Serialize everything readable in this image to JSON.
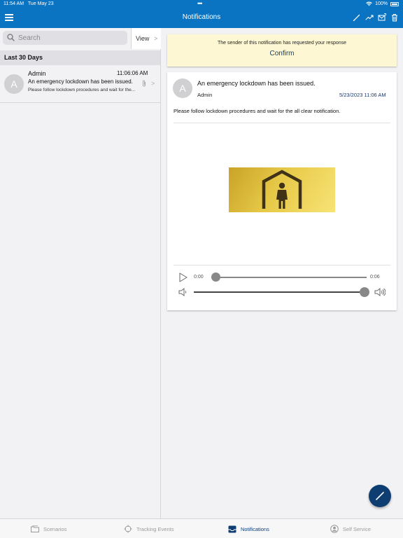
{
  "status": {
    "time": "11:54 AM",
    "date": "Tue May 23",
    "battery": "100%"
  },
  "navbar": {
    "title": "Notifications",
    "icons": [
      "menu-icon",
      "pencil-icon",
      "trend-icon",
      "mail-icon",
      "trash-icon"
    ]
  },
  "left": {
    "search_placeholder": "Search",
    "view_label": "View",
    "section_header": "Last 30 Days",
    "items": [
      {
        "avatar": "A",
        "sender": "Admin",
        "time": "11:06:06 AM",
        "subject": "An emergency lockdown has been issued.",
        "preview": "Please follow lockdown procedures and wait for the..."
      }
    ]
  },
  "detail": {
    "response_request": "The sender of this notification has requested your response",
    "confirm_label": "Confirm",
    "avatar": "A",
    "subject": "An emergency lockdown has been issued.",
    "sender": "Admin",
    "date": "5/23/2023 11:06 AM",
    "body": "Please follow lockdown procedures and wait for the all clear notification.",
    "audio": {
      "current": "0:00",
      "total": "0:06",
      "progress": 0.0,
      "volume": 1.0
    }
  },
  "tabs": [
    {
      "label": "Scenarios",
      "icon": "folder-icon",
      "active": false
    },
    {
      "label": "Tracking Events",
      "icon": "location-icon",
      "active": false
    },
    {
      "label": "Notifications",
      "icon": "inbox-icon",
      "active": true
    },
    {
      "label": "Self Service",
      "icon": "person-icon",
      "active": false
    }
  ],
  "colors": {
    "brand": "#0a74c2",
    "accent_dark": "#0e3d72",
    "confirm_bg": "#fdf7d3"
  }
}
